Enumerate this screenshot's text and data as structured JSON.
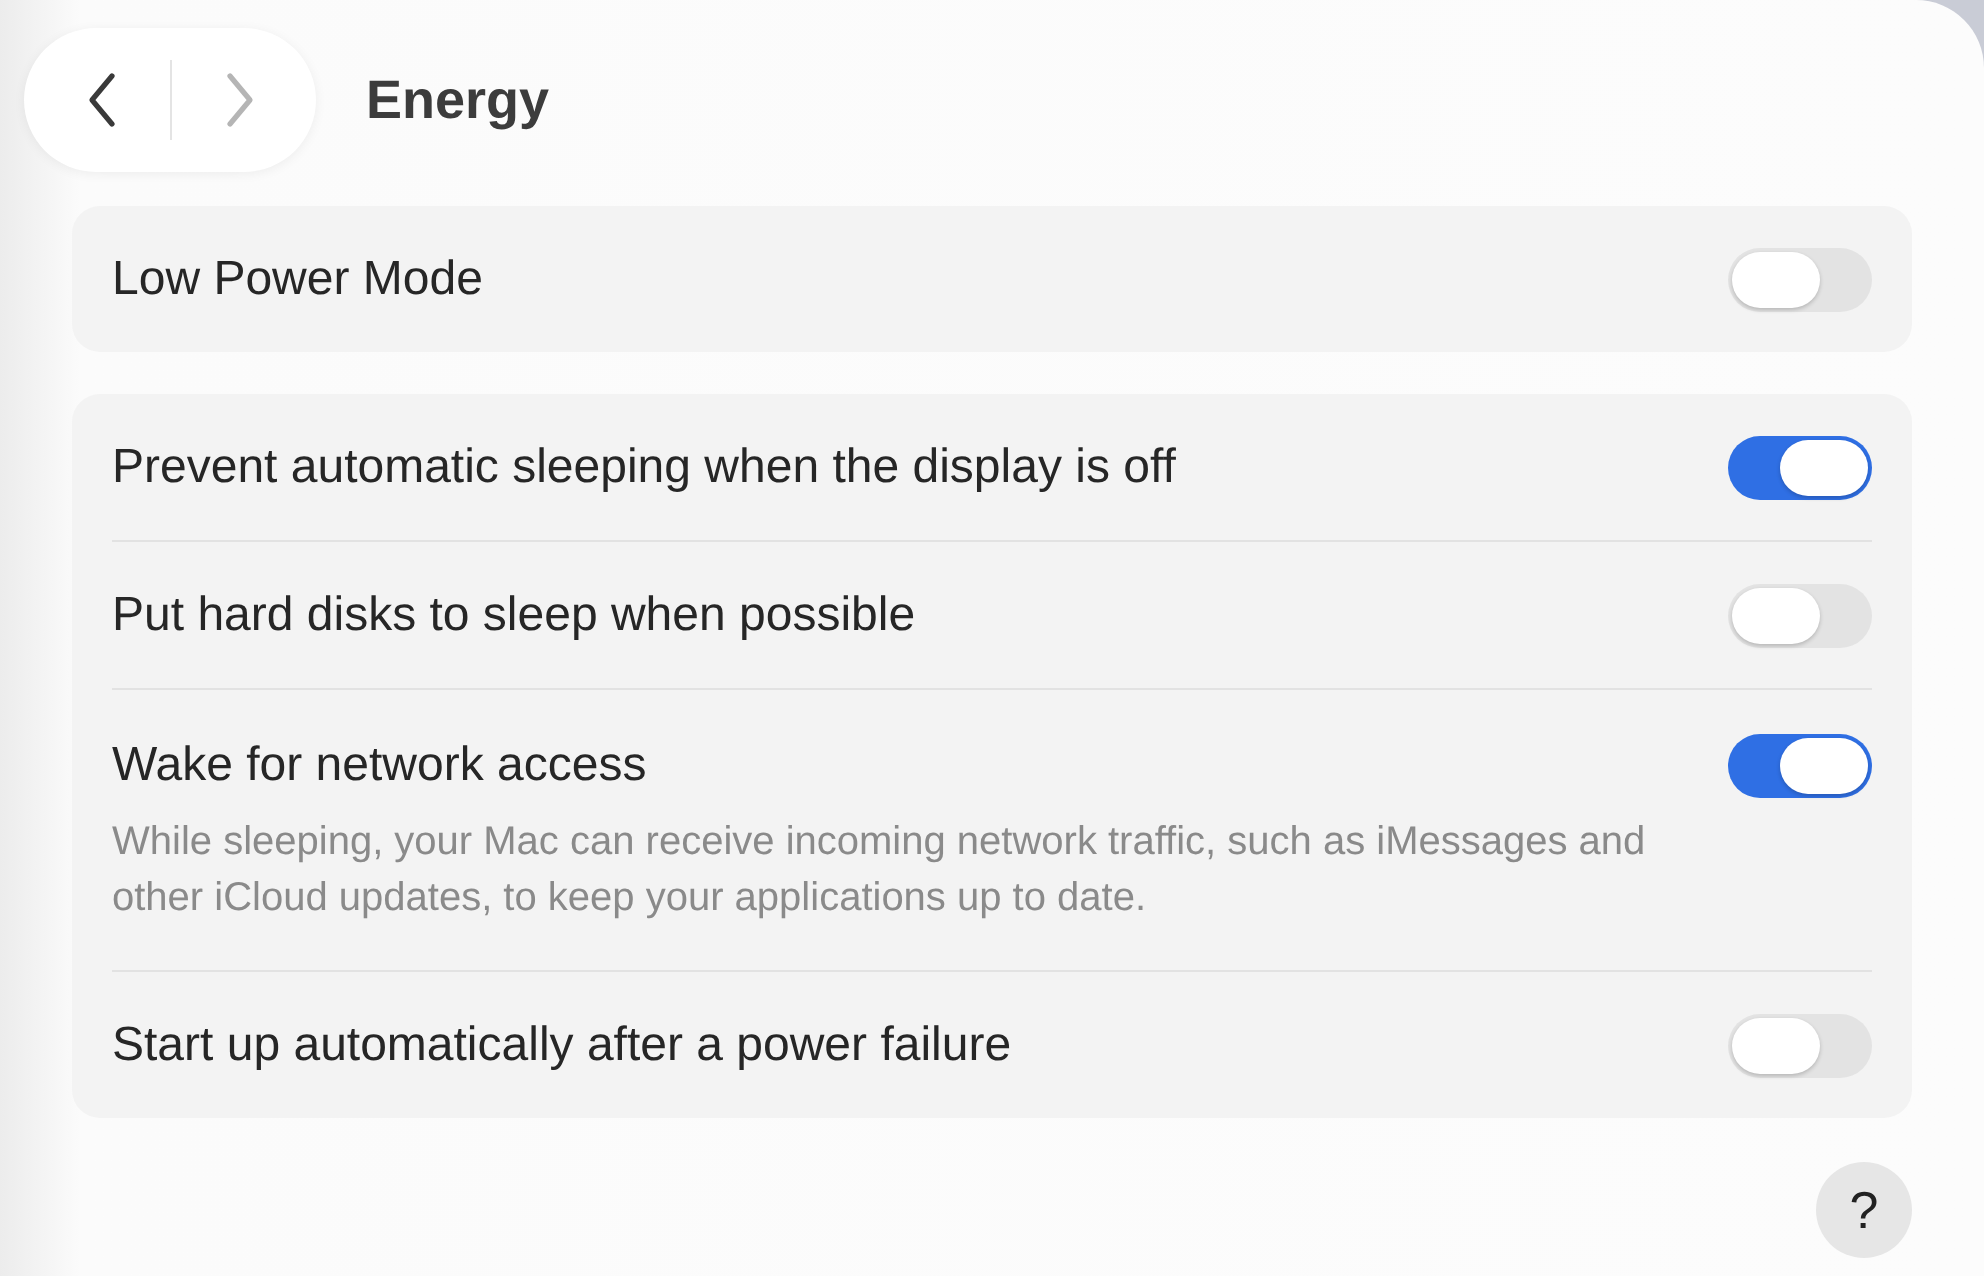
{
  "nav": [
    {
      "kind": "back",
      "disabled": false
    },
    {
      "kind": "forward",
      "disabled": true
    }
  ],
  "title": "Energy",
  "groups": [
    {
      "rows": [
        {
          "label": "Low Power Mode",
          "on": false
        }
      ]
    },
    {
      "rows": [
        {
          "label": "Prevent automatic sleeping when the display is off",
          "on": true
        },
        {
          "label": "Put hard disks to sleep when possible",
          "on": false
        },
        {
          "label": "Wake for network access",
          "on": true,
          "description": "While sleeping, your Mac can receive incoming network traffic, such as iMessages and other iCloud updates, to keep your applications up to date."
        },
        {
          "label": "Start up automatically after a power failure",
          "on": false
        }
      ]
    }
  ],
  "help": "?"
}
